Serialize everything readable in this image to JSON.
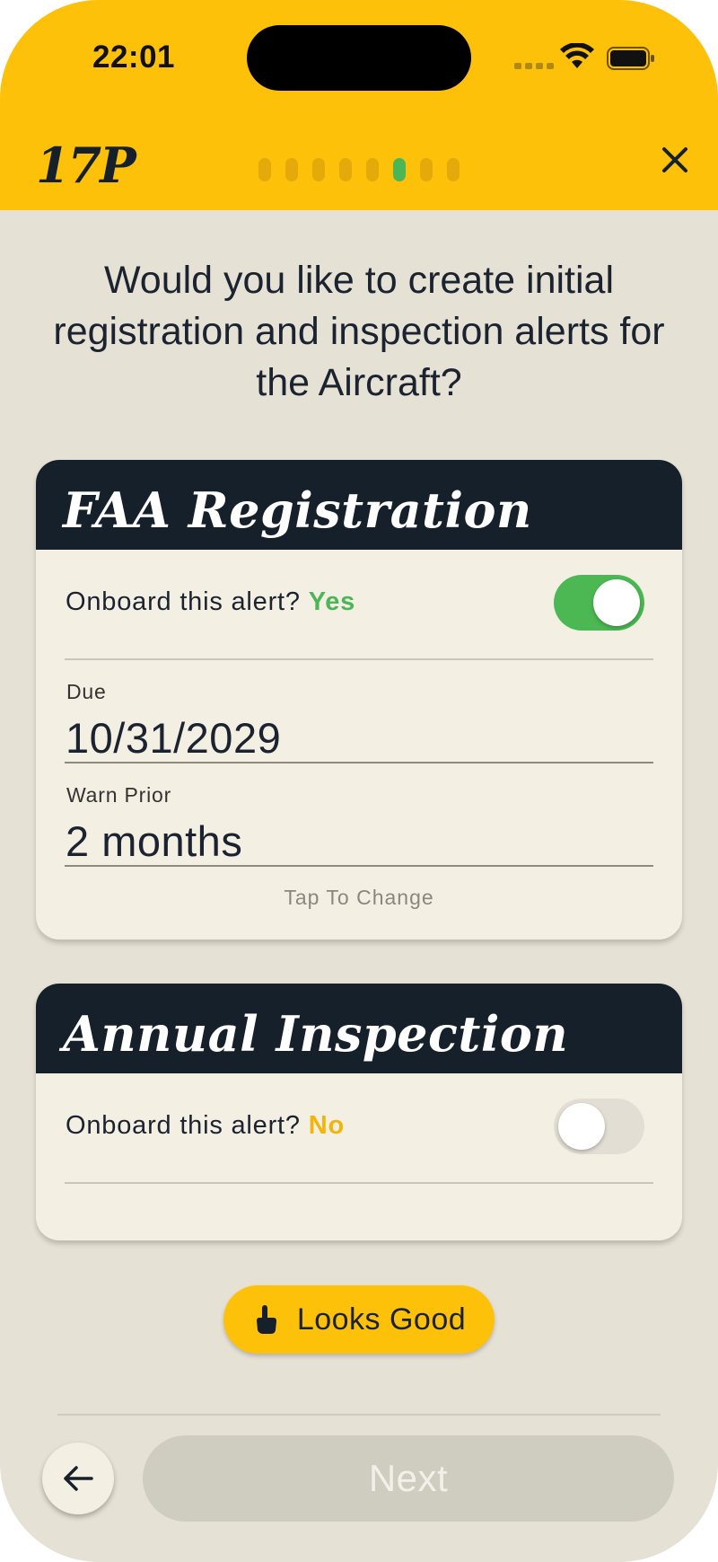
{
  "status_bar": {
    "time": "22:01"
  },
  "header": {
    "brand": "17P",
    "progress": {
      "total_steps": 8,
      "current_step": 6
    },
    "close_icon": "close-icon"
  },
  "question": "Would you like to create initial registration and inspection alerts for the Aircraft?",
  "cards": [
    {
      "title": "FAA Registration",
      "onboard_label": "Onboard this alert?",
      "onboard_answer": "Yes",
      "toggle_on": true,
      "due_label": "Due",
      "due_value": "10/31/2029",
      "warn_label": "Warn Prior",
      "warn_value": "2 months",
      "tap_hint": "Tap To Change"
    },
    {
      "title": "Annual Inspection",
      "onboard_label": "Onboard this alert?",
      "onboard_answer": "No",
      "toggle_on": false
    }
  ],
  "actions": {
    "looks_good": "Looks Good",
    "next": "Next",
    "back_icon": "arrow-left-icon"
  },
  "colors": {
    "header_yellow": "#fec10a",
    "card_header_navy": "#16202b",
    "yes_green": "#4cb556",
    "no_yellow": "#f2b50c",
    "background": "#e5e1d5"
  }
}
